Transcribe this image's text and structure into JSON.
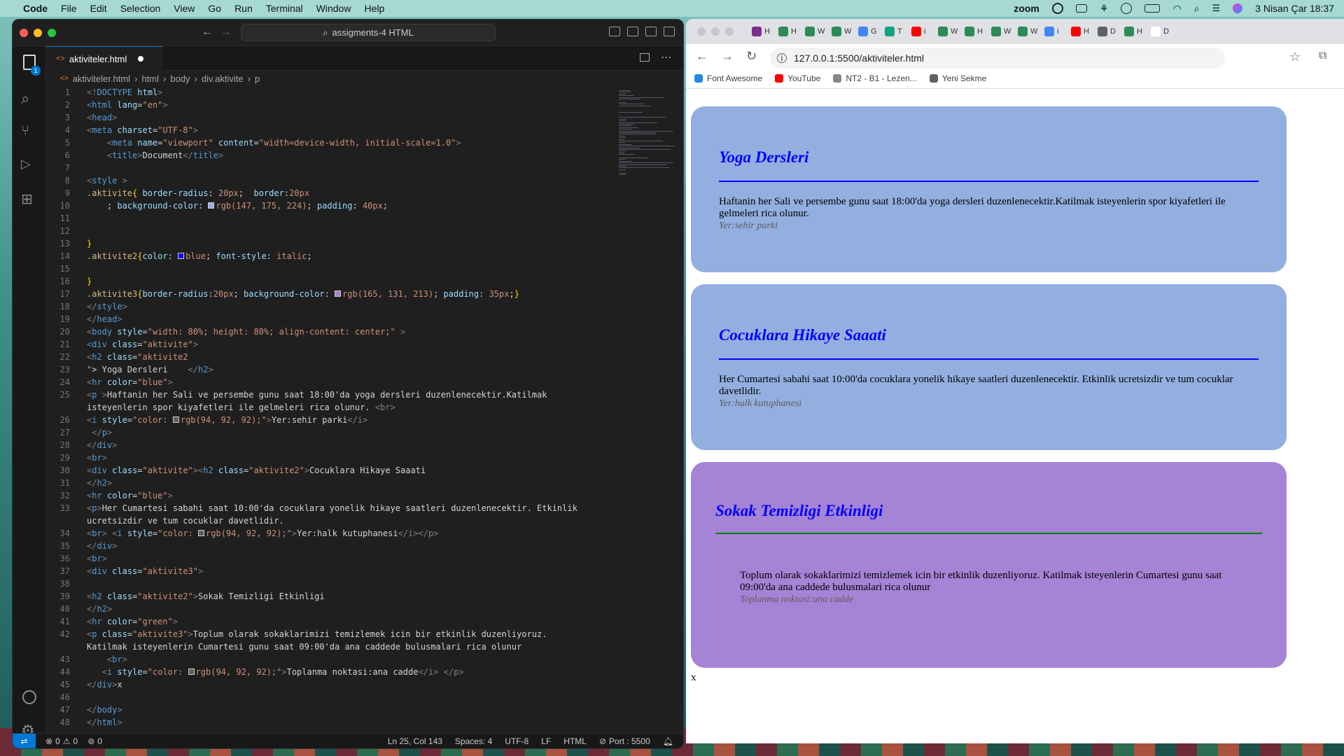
{
  "menubar": {
    "app": "Code",
    "items": [
      "File",
      "Edit",
      "Selection",
      "View",
      "Go",
      "Run",
      "Terminal",
      "Window",
      "Help"
    ],
    "zoom": "zoom",
    "datetime": "3 Nisan Çar  18:37"
  },
  "vscode": {
    "search": "assigments-4 HTML",
    "tab_label": "aktiviteler.html",
    "explorer_badge": "1",
    "breadcrumb": [
      "aktiviteler.html",
      "html",
      "body",
      "div.aktivite",
      "p"
    ],
    "status": {
      "errors": "0",
      "warnings": "0",
      "ports": "0",
      "position": "Ln 25, Col 143",
      "spaces": "Spaces: 4",
      "encoding": "UTF-8",
      "eol": "LF",
      "language": "HTML",
      "port": "Port : 5500"
    },
    "code_lines": [
      {
        "n": "1",
        "html": "<span class=\"gr\">&lt;!</span><span class=\"tg\">DOCTYPE</span> <span class=\"at\">html</span><span class=\"gr\">&gt;</span>"
      },
      {
        "n": "2",
        "html": "<span class=\"gr\">&lt;</span><span class=\"tg\">html</span> <span class=\"at\">lang</span>=<span class=\"st\">\"en\"</span><span class=\"gr\">&gt;</span>"
      },
      {
        "n": "3",
        "html": "<span class=\"gr\">&lt;</span><span class=\"tg\">head</span><span class=\"gr\">&gt;</span>"
      },
      {
        "n": "4",
        "html": "<span class=\"gr\">&lt;</span><span class=\"tg\">meta</span> <span class=\"at\">charset</span>=<span class=\"st\">\"UTF-8\"</span><span class=\"gr\">&gt;</span>"
      },
      {
        "n": "5",
        "html": "    <span class=\"gr\">&lt;</span><span class=\"tg\">meta</span> <span class=\"at\">name</span>=<span class=\"st\">\"viewport\"</span> <span class=\"at\">content</span>=<span class=\"st\">\"width=device-width, initial-scale=1.0\"</span><span class=\"gr\">&gt;</span>"
      },
      {
        "n": "6",
        "html": "    <span class=\"gr\">&lt;</span><span class=\"tg\">title</span><span class=\"gr\">&gt;</span>Document<span class=\"gr\">&lt;/</span><span class=\"tg\">title</span><span class=\"gr\">&gt;</span>"
      },
      {
        "n": "7",
        "html": ""
      },
      {
        "n": "8",
        "html": "<span class=\"gr\">&lt;</span><span class=\"tg\">style</span> <span class=\"gr\">&gt;</span>"
      },
      {
        "n": "9",
        "html": "<span class=\"sel\">.aktivite</span><span class=\"br\">{</span> <span class=\"pr\">border-radius</span>: <span class=\"st\">20px</span>;  <span class=\"pr\">border</span>:<span class=\"st\">20px</span>"
      },
      {
        "n": "10",
        "html": "    ; <span class=\"pr\">background-color</span>: <span class=\"sw\" style=\"background:rgb(147,175,224)\"></span><span class=\"st\">rgb(147, 175, 224)</span>; <span class=\"pr\">padding</span>: <span class=\"st\">40px</span>;"
      },
      {
        "n": "11",
        "html": ""
      },
      {
        "n": "12",
        "html": ""
      },
      {
        "n": "13",
        "html": "<span class=\"br\">}</span>"
      },
      {
        "n": "14",
        "html": "<span class=\"sel\">.aktivite2</span><span class=\"br\">{</span><span class=\"pr\">color</span>: <span class=\"sw\" style=\"background:blue\"></span><span class=\"st\">blue</span>; <span class=\"pr\">font-style</span>: <span class=\"st\">italic</span>;"
      },
      {
        "n": "15",
        "html": ""
      },
      {
        "n": "16",
        "html": "<span class=\"br\">}</span>"
      },
      {
        "n": "17",
        "html": "<span class=\"sel\">.aktivite3</span><span class=\"br\">{</span><span class=\"pr\">border-radius</span>:<span class=\"st\">20px</span>; <span class=\"pr\">background-color</span>: <span class=\"sw\" style=\"background:rgb(165,131,213)\"></span><span class=\"st\">rgb(165, 131, 213)</span>; <span class=\"pr\">padding</span>: <span class=\"st\">35px</span>;<span class=\"br\">}</span>"
      },
      {
        "n": "18",
        "html": "<span class=\"gr\">&lt;/</span><span class=\"tg\">style</span><span class=\"gr\">&gt;</span>"
      },
      {
        "n": "19",
        "html": "<span class=\"gr\">&lt;/</span><span class=\"tg\">head</span><span class=\"gr\">&gt;</span>"
      },
      {
        "n": "20",
        "html": "<span class=\"gr\">&lt;</span><span class=\"tg\">body</span> <span class=\"at\">style</span>=<span class=\"st\">\"width: 80%; height: 80%; align-content: center;\"</span> <span class=\"gr\">&gt;</span>"
      },
      {
        "n": "21",
        "html": "<span class=\"gr\">&lt;</span><span class=\"tg\">div</span> <span class=\"at\">class</span>=<span class=\"st\">\"aktivite\"</span><span class=\"gr\">&gt;</span>"
      },
      {
        "n": "22",
        "html": "<span class=\"gr\">&lt;</span><span class=\"tg\">h2</span> <span class=\"at\">class</span>=<span class=\"st\">\"aktivite2</span>"
      },
      {
        "n": "23",
        "html": "<span class=\"st\">\"</span>&gt; Yoga Dersleri    <span class=\"gr\">&lt;/</span><span class=\"tg\">h2</span><span class=\"gr\">&gt;</span>"
      },
      {
        "n": "24",
        "html": "<span class=\"gr\">&lt;</span><span class=\"tg\">hr</span> <span class=\"at\">color</span>=<span class=\"st\">\"blue\"</span><span class=\"gr\">&gt;</span>"
      },
      {
        "n": "25",
        "html": "<span class=\"gr\">&lt;</span><span class=\"tg\">p</span> <span class=\"gr\">&gt;</span>Haftanin her Sali ve persembe gunu saat 18:00'da yoga dersleri duzenlenecektir.Katilmak"
      },
      {
        "n": "",
        "html": "isteyenlerin spor kiyafetleri ile gelmeleri rica olunur. <span class=\"gr\">&lt;br&gt;</span>"
      },
      {
        "n": "26",
        "html": "<span class=\"gr\">&lt;</span><span class=\"tg\">i</span> <span class=\"at\">style</span>=<span class=\"st\">\"color: </span><span class=\"sw\" style=\"background:rgb(94,92,92)\"></span><span class=\"st\">rgb(94, 92, 92);\"</span><span class=\"gr\">&gt;</span>Yer:sehir parki<span class=\"gr\">&lt;/i&gt;</span>"
      },
      {
        "n": "27",
        "html": " <span class=\"gr\">&lt;/</span><span class=\"tg\">p</span><span class=\"gr\">&gt;</span>"
      },
      {
        "n": "28",
        "html": "<span class=\"gr\">&lt;/</span><span class=\"tg\">div</span><span class=\"gr\">&gt;</span>"
      },
      {
        "n": "29",
        "html": "<span class=\"gr\">&lt;</span><span class=\"tg\">br</span><span class=\"gr\">&gt;</span>"
      },
      {
        "n": "30",
        "html": "<span class=\"gr\">&lt;</span><span class=\"tg\">div</span> <span class=\"at\">class</span>=<span class=\"st\">\"aktivite\"</span><span class=\"gr\">&gt;&lt;</span><span class=\"tg\">h2</span> <span class=\"at\">class</span>=<span class=\"st\">\"aktivite2\"</span><span class=\"gr\">&gt;</span>Cocuklara Hikaye Saaati"
      },
      {
        "n": "31",
        "html": "<span class=\"gr\">&lt;/</span><span class=\"tg\">h2</span><span class=\"gr\">&gt;</span>"
      },
      {
        "n": "32",
        "html": "<span class=\"gr\">&lt;</span><span class=\"tg\">hr</span> <span class=\"at\">color</span>=<span class=\"st\">\"blue\"</span><span class=\"gr\">&gt;</span>"
      },
      {
        "n": "33",
        "html": "<span class=\"gr\">&lt;</span><span class=\"tg\">p</span><span class=\"gr\">&gt;</span>Her Cumartesi sabahi saat 10:00'da cocuklara yonelik hikaye saatleri duzenlenecektir. Etkinlik"
      },
      {
        "n": "",
        "html": "ucretsizdir ve tum cocuklar davetlidir."
      },
      {
        "n": "34",
        "html": "<span class=\"gr\">&lt;</span><span class=\"tg\">br</span><span class=\"gr\">&gt;</span> <span class=\"gr\">&lt;</span><span class=\"tg\">i</span> <span class=\"at\">style</span>=<span class=\"st\">\"color: </span><span class=\"sw\" style=\"background:rgb(94,92,92)\"></span><span class=\"st\">rgb(94, 92, 92);\"</span><span class=\"gr\">&gt;</span>Yer:halk kutuphanesi<span class=\"gr\">&lt;/i&gt;&lt;/p&gt;</span>"
      },
      {
        "n": "35",
        "html": "<span class=\"gr\">&lt;/</span><span class=\"tg\">div</span><span class=\"gr\">&gt;</span>"
      },
      {
        "n": "36",
        "html": "<span class=\"gr\">&lt;</span><span class=\"tg\">br</span><span class=\"gr\">&gt;</span>"
      },
      {
        "n": "37",
        "html": "<span class=\"gr\">&lt;</span><span class=\"tg\">div</span> <span class=\"at\">class</span>=<span class=\"st\">\"aktivite3\"</span><span class=\"gr\">&gt;</span>"
      },
      {
        "n": "38",
        "html": ""
      },
      {
        "n": "39",
        "html": "<span class=\"gr\">&lt;</span><span class=\"tg\">h2</span> <span class=\"at\">class</span>=<span class=\"st\">\"aktivite2\"</span><span class=\"gr\">&gt;</span>Sokak Temizligi Etkinligi"
      },
      {
        "n": "40",
        "html": "<span class=\"gr\">&lt;/</span><span class=\"tg\">h2</span><span class=\"gr\">&gt;</span>"
      },
      {
        "n": "41",
        "html": "<span class=\"gr\">&lt;</span><span class=\"tg\">hr</span> <span class=\"at\">color</span>=<span class=\"st\">\"green\"</span><span class=\"gr\">&gt;</span>"
      },
      {
        "n": "42",
        "html": "<span class=\"gr\">&lt;</span><span class=\"tg\">p</span> <span class=\"at\">class</span>=<span class=\"st\">\"aktivite3\"</span><span class=\"gr\">&gt;</span>Toplum olarak sokaklarimizi temizlemek icin bir etkinlik duzenliyoruz."
      },
      {
        "n": "",
        "html": "Katilmak isteyenlerin Cumartesi gunu saat 09:00'da ana caddede bulusmalari rica olunur"
      },
      {
        "n": "43",
        "html": "    <span class=\"gr\">&lt;</span><span class=\"tg\">br</span><span class=\"gr\">&gt;</span>"
      },
      {
        "n": "44",
        "html": "   <span class=\"gr\">&lt;</span><span class=\"tg\">i</span> <span class=\"at\">style</span>=<span class=\"st\">\"color: </span><span class=\"sw\" style=\"background:rgb(94,92,92)\"></span><span class=\"st\">rgb(94, 92, 92);\"</span><span class=\"gr\">&gt;</span>Toplanma noktasi:ana cadde<span class=\"gr\">&lt;/i&gt;</span> <span class=\"gr\">&lt;/p&gt;</span>"
      },
      {
        "n": "45",
        "html": "<span class=\"gr\">&lt;/</span><span class=\"tg\">div</span><span class=\"gr\">&gt;</span>x"
      },
      {
        "n": "46",
        "html": ""
      },
      {
        "n": "47",
        "html": "<span class=\"gr\">&lt;/</span><span class=\"tg\">body</span><span class=\"gr\">&gt;</span>"
      },
      {
        "n": "48",
        "html": "<span class=\"gr\">&lt;/</span><span class=\"tg\">html</span><span class=\"gr\">&gt;</span>"
      }
    ]
  },
  "chrome": {
    "tabs": [
      {
        "label": "H",
        "color": "#7b2e8e"
      },
      {
        "label": "H",
        "color": "#2e8b57"
      },
      {
        "label": "W",
        "color": "#2e8b57"
      },
      {
        "label": "W",
        "color": "#2e8b57"
      },
      {
        "label": "G",
        "color": "#4285f4"
      },
      {
        "label": "T",
        "color": "#10a37f"
      },
      {
        "label": "i",
        "color": "#ff0000"
      },
      {
        "label": "W",
        "color": "#2e8b57"
      },
      {
        "label": "H",
        "color": "#2e8b57"
      },
      {
        "label": "W",
        "color": "#2e8b57"
      },
      {
        "label": "W",
        "color": "#2e8b57"
      },
      {
        "label": "i",
        "color": "#4285f4"
      },
      {
        "label": "H",
        "color": "#ff0000"
      },
      {
        "label": "D",
        "color": "#5f6368"
      },
      {
        "label": "H",
        "color": "#2e8b57"
      },
      {
        "label": "D",
        "color": "#ffffff"
      }
    ],
    "url": "127.0.0.1:5500/aktiviteler.html",
    "bookmarks": [
      {
        "label": "Font Awesome",
        "color": "#228ae6"
      },
      {
        "label": "YouTube",
        "color": "#ff0000"
      },
      {
        "label": "NT2 - B1 - Lezen...",
        "color": "#888"
      },
      {
        "label": "Yeni Sekme",
        "color": "#5f6368"
      }
    ]
  },
  "page": {
    "cards": [
      {
        "title": "Yoga Dersleri",
        "text": "Haftanin her Sali ve persembe gunu saat 18:00'da yoga dersleri duzenlenecektir.Katilmak isteyenlerin spor kiyafetleri ile gelmeleri rica olunur.",
        "location": "Yer:sehir parki",
        "bg": "rgb(147,175,224)",
        "hr_color": "blue"
      },
      {
        "title": "Cocuklara Hikaye Saaati",
        "text": "Her Cumartesi sabahi saat 10:00'da cocuklara yonelik hikaye saatleri duzenlenecektir. Etkinlik ucretsizdir ve tum cocuklar davetlidir.",
        "location": "Yer:halk kutuphanesi",
        "bg": "rgb(147,175,224)",
        "hr_color": "blue"
      },
      {
        "title": "Sokak Temizligi Etkinligi",
        "text": "Toplum olarak sokaklarimizi temizlemek icin bir etkinlik duzenliyoruz. Katilmak isteyenlerin Cumartesi gunu saat 09:00'da ana caddede bulusmalari rica olunur",
        "location": "Toplanma noktasi:ana cadde",
        "bg": "rgb(165,131,213)",
        "hr_color": "green"
      }
    ],
    "trailing": "x"
  }
}
